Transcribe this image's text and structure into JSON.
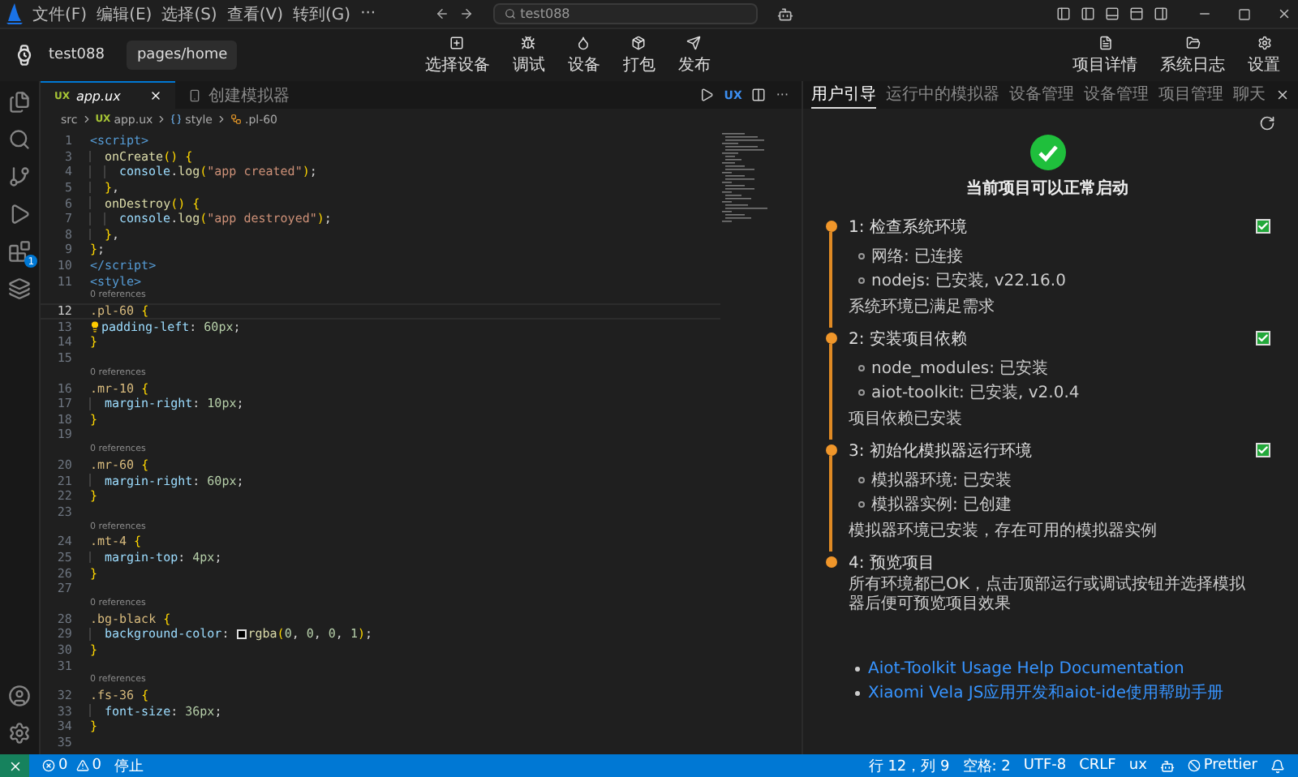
{
  "title_bar": {
    "menus": [
      "文件(F)",
      "编辑(E)",
      "选择(S)",
      "查看(V)",
      "转到(G)"
    ],
    "more": "···",
    "search": {
      "value": "test088"
    }
  },
  "toolbar": {
    "device": "test088",
    "page": "pages/home",
    "actions": [
      "选择设备",
      "调试",
      "设备",
      "打包",
      "发布"
    ],
    "right_actions": [
      "项目详情",
      "系统日志",
      "设置"
    ]
  },
  "activity_bar": {
    "extensions_badge": "1"
  },
  "editor": {
    "tabs": [
      {
        "label": "app.ux",
        "icon_text": "UX",
        "selected": true,
        "kind": "file"
      },
      {
        "label": "创建模拟器",
        "selected": false,
        "kind": "simulator"
      }
    ],
    "file_type": "UX",
    "more": "···",
    "breadcrumb": [
      {
        "label": "src",
        "kind": "folder"
      },
      {
        "label": "app.ux",
        "icon_text": "UX",
        "kind": "file"
      },
      {
        "label": "style",
        "kind": "element"
      },
      {
        "label": ".pl-60",
        "kind": "class"
      }
    ],
    "lines": [
      {
        "kind": "code",
        "n": "1",
        "current": false,
        "hint": false,
        "text": "<script>"
      },
      {
        "kind": "code",
        "n": "3",
        "current": false,
        "hint": false,
        "text": "  onCreate() {"
      },
      {
        "kind": "code",
        "n": "4",
        "current": false,
        "hint": false,
        "text": "    console.log(\"app created\");"
      },
      {
        "kind": "code",
        "n": "5",
        "current": false,
        "hint": false,
        "text": "  },"
      },
      {
        "kind": "code",
        "n": "6",
        "current": false,
        "hint": false,
        "text": "  onDestroy() {"
      },
      {
        "kind": "code",
        "n": "7",
        "current": false,
        "hint": false,
        "text": "    console.log(\"app destroyed\");"
      },
      {
        "kind": "code",
        "n": "8",
        "current": false,
        "hint": false,
        "text": "  },"
      },
      {
        "kind": "code",
        "n": "9",
        "current": false,
        "hint": false,
        "text": "};"
      },
      {
        "kind": "code",
        "n": "10",
        "current": false,
        "hint": false,
        "text": "</script>"
      },
      {
        "kind": "code",
        "n": "11",
        "current": false,
        "hint": false,
        "text": "<style>"
      },
      {
        "kind": "refs",
        "text": "0 references"
      },
      {
        "kind": "code",
        "n": "12",
        "current": true,
        "hint": false,
        "text": ".pl-60 {"
      },
      {
        "kind": "code",
        "n": "13",
        "current": false,
        "hint": true,
        "text": "padding-left: 60px;"
      },
      {
        "kind": "code",
        "n": "14",
        "current": false,
        "hint": false,
        "text": "}"
      },
      {
        "kind": "code",
        "n": "15",
        "current": false,
        "hint": false
      },
      {
        "kind": "refs",
        "text": "0 references"
      },
      {
        "kind": "code",
        "n": "16",
        "current": false,
        "hint": false,
        "text": ".mr-10 {"
      },
      {
        "kind": "code",
        "n": "17",
        "current": false,
        "hint": false,
        "text": "  margin-right: 10px;"
      },
      {
        "kind": "code",
        "n": "18",
        "current": false,
        "hint": false,
        "text": "}"
      },
      {
        "kind": "code",
        "n": "19",
        "current": false,
        "hint": false
      },
      {
        "kind": "refs",
        "text": "0 references"
      },
      {
        "kind": "code",
        "n": "20",
        "current": false,
        "hint": false,
        "text": ".mr-60 {"
      },
      {
        "kind": "code",
        "n": "21",
        "current": false,
        "hint": false,
        "text": "  margin-right: 60px;"
      },
      {
        "kind": "code",
        "n": "22",
        "current": false,
        "hint": false,
        "text": "}"
      },
      {
        "kind": "code",
        "n": "23",
        "current": false,
        "hint": false
      },
      {
        "kind": "refs",
        "text": "0 references"
      },
      {
        "kind": "code",
        "n": "24",
        "current": false,
        "hint": false,
        "text": ".mt-4 {"
      },
      {
        "kind": "code",
        "n": "25",
        "current": false,
        "hint": false,
        "text": "  margin-top: 4px;"
      },
      {
        "kind": "code",
        "n": "26",
        "current": false,
        "hint": false,
        "text": "}"
      },
      {
        "kind": "code",
        "n": "27",
        "current": false,
        "hint": false
      },
      {
        "kind": "refs",
        "text": "0 references"
      },
      {
        "kind": "code",
        "n": "28",
        "current": false,
        "hint": false,
        "text": ".bg-black {"
      },
      {
        "kind": "code",
        "n": "29",
        "current": false,
        "hint": false,
        "text": "  background-color: ",
        "after_swatch": "rgba(0, 0, 0, 1);"
      },
      {
        "kind": "code",
        "n": "30",
        "current": false,
        "hint": false,
        "text": "}"
      },
      {
        "kind": "code",
        "n": "31",
        "current": false,
        "hint": false
      },
      {
        "kind": "refs",
        "text": "0 references"
      },
      {
        "kind": "code",
        "n": "32",
        "current": false,
        "hint": false,
        "text": ".fs-36 {"
      },
      {
        "kind": "code",
        "n": "33",
        "current": false,
        "hint": false,
        "text": "  font-size: 36px;"
      },
      {
        "kind": "code",
        "n": "34",
        "current": false,
        "hint": false,
        "text": "}"
      },
      {
        "kind": "code",
        "n": "35",
        "current": false,
        "hint": false
      }
    ]
  },
  "panel": {
    "tabs": [
      {
        "label": "用户引导",
        "selected": true
      },
      {
        "label": "运行中的模拟器",
        "selected": false
      },
      {
        "label": "设备管理",
        "selected": false
      },
      {
        "label": "设备管理",
        "selected": false
      },
      {
        "label": "项目管理",
        "selected": false
      },
      {
        "label": "聊天",
        "selected": false
      }
    ],
    "status_title": "当前项目可以正常启动",
    "steps": [
      {
        "title": "1: 检查系统环境",
        "done": true,
        "items": [
          "网络: 已连接",
          "nodejs: 已安装, v22.16.0"
        ],
        "summary": "系统环境已满足需求"
      },
      {
        "title": "2: 安装项目依赖",
        "done": true,
        "items": [
          "node_modules: 已安装",
          "aiot-toolkit: 已安装, v2.0.4"
        ],
        "summary": "项目依赖已安装"
      },
      {
        "title": "3: 初始化模拟器运行环境",
        "done": true,
        "items": [
          "模拟器环境: 已安装",
          "模拟器实例: 已创建"
        ],
        "summary": "模拟器环境已安装，存在可用的模拟器实例"
      },
      {
        "title": "4: 预览项目",
        "done": false,
        "summary": "所有环境都已OK，点击顶部运行或调试按钮并选择模拟器后便可预览项目效果"
      }
    ],
    "links": [
      "Aiot-Toolkit Usage Help Documentation",
      "Xiaomi Vela JS应用开发和aiot-ide使用帮助手册"
    ]
  },
  "status_bar": {
    "errors": "0",
    "warnings": "0",
    "task": "停止",
    "items": [
      "行 12，列 9",
      "空格: 2",
      "UTF-8",
      "CRLF",
      "ux"
    ],
    "formatter": "Prettier"
  }
}
